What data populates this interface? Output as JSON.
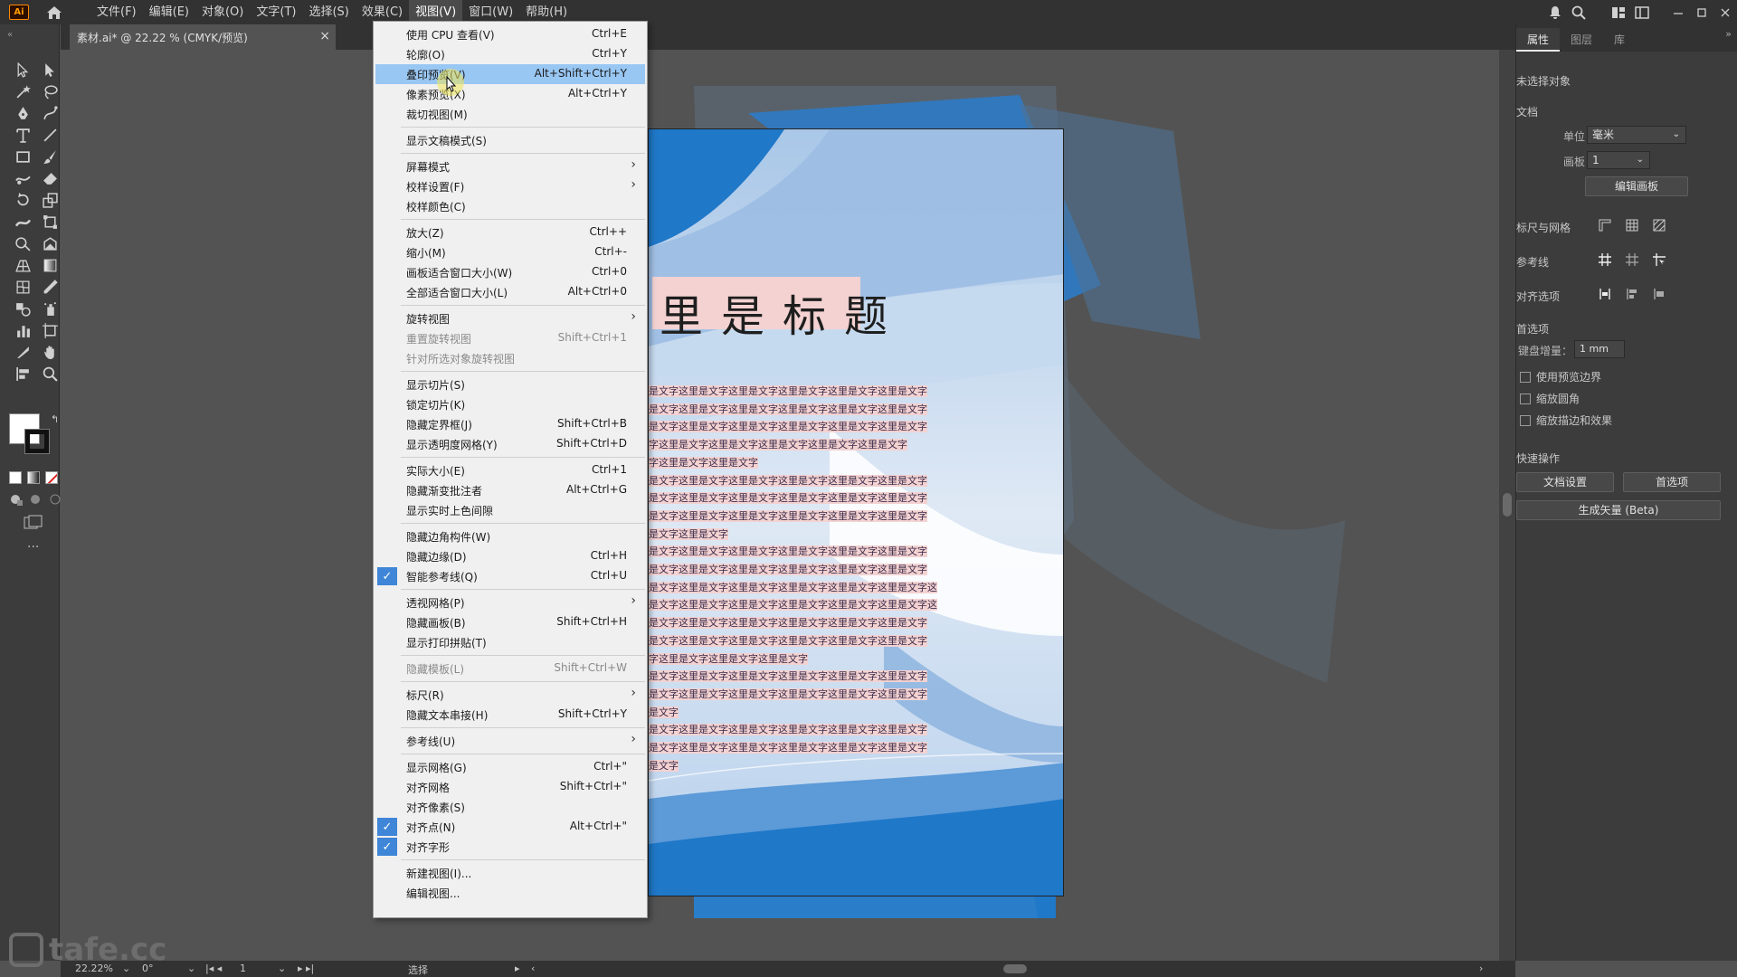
{
  "app": {
    "logo": "Ai",
    "menus": [
      "文件(F)",
      "编辑(E)",
      "对象(O)",
      "文字(T)",
      "选择(S)",
      "效果(C)",
      "视图(V)",
      "窗口(W)",
      "帮助(H)"
    ],
    "active_menu": "视图(V)"
  },
  "document_tab": {
    "title": "素材.ai* @ 22.22 % (CMYK/预览)",
    "close": "×"
  },
  "view_menu": {
    "items": [
      {
        "label": "使用 CPU 查看(V)",
        "shortcut": "Ctrl+E"
      },
      {
        "label": "轮廓(O)",
        "shortcut": "Ctrl+Y"
      },
      {
        "label": "叠印预览(V)",
        "shortcut": "Alt+Shift+Ctrl+Y",
        "highlighted": true
      },
      {
        "label": "像素预览(X)",
        "shortcut": "Alt+Ctrl+Y"
      },
      {
        "label": "裁切视图(M)",
        "shortcut": ""
      },
      {
        "label": "显示文稿模式(S)",
        "shortcut": ""
      },
      {
        "label": "屏幕模式",
        "shortcut": "",
        "submenu": true
      },
      {
        "label": "校样设置(F)",
        "shortcut": "",
        "submenu": true
      },
      {
        "label": "校样颜色(C)",
        "shortcut": ""
      },
      {
        "label": "放大(Z)",
        "shortcut": "Ctrl++"
      },
      {
        "label": "缩小(M)",
        "shortcut": "Ctrl+-"
      },
      {
        "label": "画板适合窗口大小(W)",
        "shortcut": "Ctrl+0"
      },
      {
        "label": "全部适合窗口大小(L)",
        "shortcut": "Alt+Ctrl+0"
      },
      {
        "label": "旋转视图",
        "shortcut": "",
        "submenu": true
      },
      {
        "label": "重置旋转视图",
        "shortcut": "Shift+Ctrl+1",
        "disabled": true
      },
      {
        "label": "针对所选对象旋转视图",
        "shortcut": "",
        "disabled": true
      },
      {
        "label": "显示切片(S)",
        "shortcut": ""
      },
      {
        "label": "锁定切片(K)",
        "shortcut": ""
      },
      {
        "label": "隐藏定界框(J)",
        "shortcut": "Shift+Ctrl+B"
      },
      {
        "label": "显示透明度网格(Y)",
        "shortcut": "Shift+Ctrl+D"
      },
      {
        "label": "实际大小(E)",
        "shortcut": "Ctrl+1"
      },
      {
        "label": "隐藏渐变批注者",
        "shortcut": "Alt+Ctrl+G"
      },
      {
        "label": "显示实时上色间隙",
        "shortcut": ""
      },
      {
        "label": "隐藏边角构件(W)",
        "shortcut": ""
      },
      {
        "label": "隐藏边缘(D)",
        "shortcut": "Ctrl+H"
      },
      {
        "label": "智能参考线(Q)",
        "shortcut": "Ctrl+U",
        "checked": true
      },
      {
        "label": "透视网格(P)",
        "shortcut": "",
        "submenu": true
      },
      {
        "label": "隐藏画板(B)",
        "shortcut": "Shift+Ctrl+H"
      },
      {
        "label": "显示打印拼贴(T)",
        "shortcut": ""
      },
      {
        "label": "隐藏模板(L)",
        "shortcut": "Shift+Ctrl+W",
        "disabled": true
      },
      {
        "label": "标尺(R)",
        "shortcut": "",
        "submenu": true
      },
      {
        "label": "隐藏文本串接(H)",
        "shortcut": "Shift+Ctrl+Y"
      },
      {
        "label": "参考线(U)",
        "shortcut": "",
        "submenu": true
      },
      {
        "label": "显示网格(G)",
        "shortcut": "Ctrl+\""
      },
      {
        "label": "对齐网格",
        "shortcut": "Shift+Ctrl+\""
      },
      {
        "label": "对齐像素(S)",
        "shortcut": ""
      },
      {
        "label": "对齐点(N)",
        "shortcut": "Alt+Ctrl+\"",
        "checked": true
      },
      {
        "label": "对齐字形",
        "shortcut": "",
        "checked": true
      },
      {
        "label": "新建视图(I)...",
        "shortcut": ""
      },
      {
        "label": "编辑视图...",
        "shortcut": ""
      }
    ]
  },
  "right_panel": {
    "tabs": [
      "属性",
      "图层",
      "库"
    ],
    "no_selection": "未选择对象",
    "document_label": "文档",
    "unit_label": "单位：",
    "unit_value": "毫米",
    "artboard_label": "画板：",
    "artboard_value": "1",
    "edit_artboard_btn": "编辑画板",
    "rulers_grid_label": "标尺与网格",
    "guides_label": "参考线",
    "align_options_label": "对齐选项",
    "preferences_label": "首选项",
    "keyboard_increment_label": "键盘增量：",
    "keyboard_increment_value": "1 mm",
    "checkbox_preview_bounds": "使用预览边界",
    "checkbox_scale_corners": "缩放圆角",
    "checkbox_scale_strokes": "缩放描边和效果",
    "quick_actions_label": "快速操作",
    "doc_setup_btn": "文档设置",
    "prefs_btn": "首选项",
    "gen_vector_btn": "生成矢量 (Beta)"
  },
  "statusbar": {
    "zoom": "22.22%",
    "rotation": "0°",
    "artboard": "1",
    "tool": "选择"
  },
  "artboard": {
    "title": "里是标题",
    "body_lines": [
      [
        "是文字这里是文字这里是文字这里是文字这里是文字这里是文字",
        "是文字这里是文字这里是文字这里是文字这里是文字这里是文字",
        "是文字这里是文字这里是文字这里是文字这里是文字这里是文字",
        "字这里是文字这里是文字这里是文字这里是文字这里是文字",
        "字这里是文字这里是文字"
      ],
      [
        "是文字这里是文字这里是文字这里是文字这里是文字这里是文字",
        "是文字这里是文字这里是文字这里是文字这里是文字这里是文字",
        "是文字这里是文字这里是文字这里是文字这里是文字这里是文字",
        "是文字这里是文字"
      ],
      [
        "是文字这里是文字这里是文字这里是文字这里是文字这里是文字",
        "是文字这里是文字这里是文字这里是文字这里是文字这里是文字",
        "是文字这里是文字这里是文字这里是文字这里是文字这里是文字这",
        "是文字这里是文字这里是文字这里是文字这里是文字这里是文字这",
        "是文字这里是文字这里是文字这里是文字这里是文字这里是文字",
        "是文字这里是文字这里是文字这里是文字这里是文字这里是文字",
        "字这里是文字这里是文字这里是文字"
      ],
      [
        "是文字这里是文字这里是文字这里是文字这里是文字这里是文字",
        "是文字这里是文字这里是文字这里是文字这里是文字这里是文字",
        "是文字"
      ],
      [
        "是文字这里是文字这里是文字这里是文字这里是文字这里是文字",
        "是文字这里是文字这里是文字这里是文字这里是文字这里是文字",
        "是文字"
      ]
    ]
  },
  "watermark": "tafe.cc",
  "colors": {
    "ui_dark": "#323232",
    "ui_panel": "#3c3c3c",
    "canvas_bg": "#535353",
    "artboard_blue": "#1f78c8",
    "menu_bg": "#f0f0f0",
    "menu_highlight": "#99c7f3",
    "check_bg": "#3f86d8",
    "title_highlight": "#f3d2d1"
  }
}
